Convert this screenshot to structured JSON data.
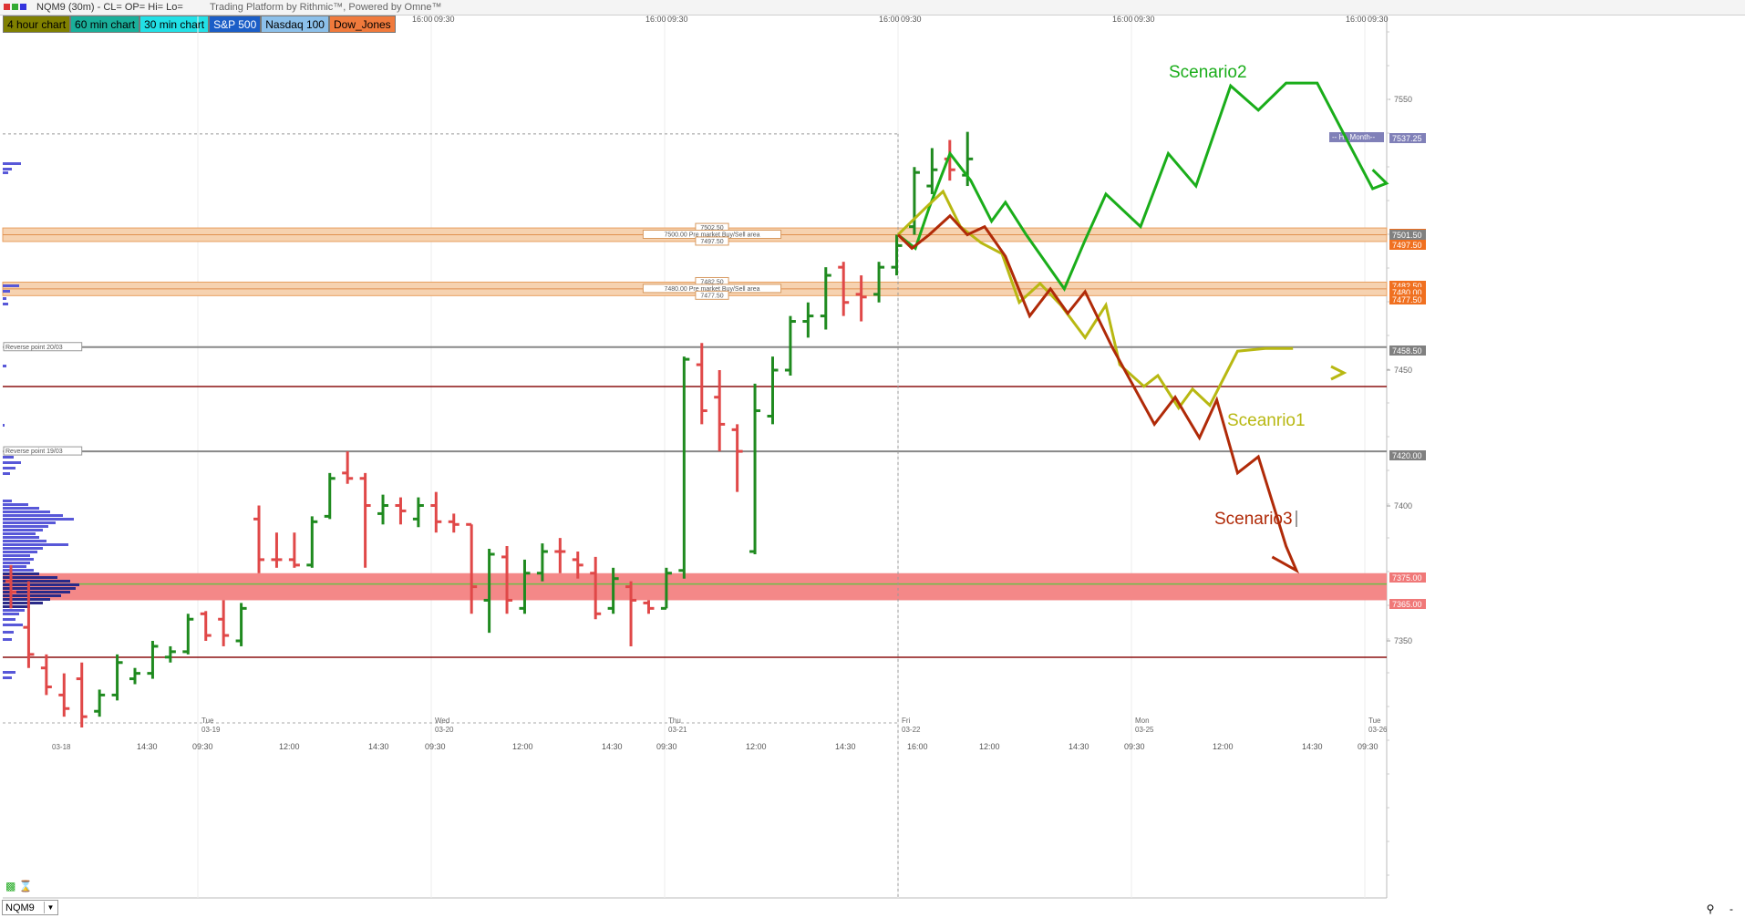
{
  "window": {
    "title": "NQM9 (30m) - CL= OP= Hi= Lo=",
    "subtitle": "Trading Platform by Rithmic™, Powered by Omne™"
  },
  "tabs": [
    {
      "label": "4 hour chart",
      "bg": "#808000",
      "fg": "#000000"
    },
    {
      "label": "60 min chart",
      "bg": "#1aaf9a",
      "fg": "#000000"
    },
    {
      "label": "30 min chart",
      "bg": "#22e0e6",
      "fg": "#000000"
    },
    {
      "label": "S&P 500",
      "bg": "#1b5ec7",
      "fg": "#ffffff"
    },
    {
      "label": "Nasdaq 100",
      "bg": "#8cc0ea",
      "fg": "#000000"
    },
    {
      "label": "Dow_Jones",
      "bg": "#f07a3c",
      "fg": "#000000"
    }
  ],
  "symbol": "NQM9",
  "colors": {
    "up_bar": "#1f8a1f",
    "down_bar": "#e04848",
    "scenario1": "#b8b812",
    "scenario2": "#1aad1a",
    "scenario3": "#b02a08",
    "zone_red": "#f48888",
    "zone_orange": "#f6d2b0",
    "profile_blue": "#5858d8"
  },
  "top_time_labels": [
    "16:00",
    "09:30",
    "16:00",
    "09:30",
    "16:00",
    "09:30",
    "16:00",
    "09:30",
    "16:00",
    "09:30"
  ],
  "bottom_date_labels": [
    "03-18",
    "Tue 03-19",
    "Wed 03-20",
    "Thu 03-21",
    "Fri 03-22",
    "Mon 03-25",
    "Tue 03-26"
  ],
  "bottom_time_labels": [
    "14:30",
    "09:30",
    "12:00",
    "14:30",
    "09:30",
    "12:00",
    "14:30",
    "09:30",
    "12:00",
    "14:30",
    "16:00",
    "12:00",
    "14:30",
    "09:30",
    "12:00",
    "14:30",
    "09:30"
  ],
  "price_axis": {
    "ticks": [
      "7550",
      "7450",
      "7400",
      "7350"
    ],
    "badges": [
      {
        "label": "7537.25",
        "color": "#8080b8"
      },
      {
        "label": "7502.50",
        "color": "#f07020"
      },
      {
        "label": "7501.50",
        "color": "#808080"
      },
      {
        "label": "7497.50",
        "color": "#f07020"
      },
      {
        "label": "7482.50",
        "color": "#f07020"
      },
      {
        "label": "7480.00",
        "color": "#f07020"
      },
      {
        "label": "7477.50",
        "color": "#f07020"
      },
      {
        "label": "7458.50",
        "color": "#808080"
      },
      {
        "label": "7420.00",
        "color": "#808080"
      },
      {
        "label": "7375.00",
        "color": "#f07878"
      },
      {
        "label": "7365.00",
        "color": "#f07878"
      }
    ]
  },
  "annotations": {
    "hi_month": "-- Hi_Month--",
    "zone1_top": "7502.50",
    "zone1_mid": "7500.00 Pre market Buy/Sell area",
    "zone1_bot": "7497.50",
    "zone2_top": "7482.50",
    "zone2_mid": "7480.00 Pre market Buy/Sell area",
    "zone2_bot": "7477.50",
    "reverse1": "Reverse point 20/03",
    "reverse2": "Reverse point 19/03",
    "scenario1": "Sceanrio1",
    "scenario2": "Scenario2",
    "scenario3": "Scenario3"
  },
  "bars": [
    [
      "d",
      7378,
      7362,
      7372,
      7368
    ],
    [
      "d",
      7372,
      7340,
      7355,
      7345
    ],
    [
      "d",
      7345,
      7330,
      7340,
      7333
    ],
    [
      "d",
      7338,
      7322,
      7330,
      7325
    ],
    [
      "d",
      7342,
      7318,
      7336,
      7322
    ],
    [
      "u",
      7332,
      7322,
      7324,
      7330
    ],
    [
      "u",
      7345,
      7328,
      7330,
      7342
    ],
    [
      "u",
      7340,
      7334,
      7336,
      7338
    ],
    [
      "u",
      7350,
      7336,
      7338,
      7348
    ],
    [
      "u",
      7348,
      7342,
      7344,
      7346
    ],
    [
      "u",
      7360,
      7345,
      7346,
      7358
    ],
    [
      "d",
      7361,
      7350,
      7360,
      7352
    ],
    [
      "d",
      7365,
      7348,
      7358,
      7352
    ],
    [
      "u",
      7364,
      7348,
      7350,
      7362
    ],
    [
      "d",
      7400,
      7375,
      7395,
      7380
    ],
    [
      "d",
      7390,
      7377,
      7380,
      7380
    ],
    [
      "d",
      7390,
      7377,
      7380,
      7378
    ],
    [
      "u",
      7396,
      7377,
      7378,
      7394
    ],
    [
      "u",
      7412,
      7395,
      7396,
      7410
    ],
    [
      "d",
      7420,
      7408,
      7412,
      7410
    ],
    [
      "d",
      7412,
      7377,
      7410,
      7400
    ],
    [
      "u",
      7404,
      7393,
      7397,
      7400
    ],
    [
      "d",
      7403,
      7393,
      7400,
      7398
    ],
    [
      "u",
      7403,
      7392,
      7395,
      7400
    ],
    [
      "d",
      7405,
      7390,
      7400,
      7394
    ],
    [
      "d",
      7397,
      7390,
      7394,
      7393
    ],
    [
      "d",
      7393,
      7360,
      7393,
      7370
    ],
    [
      "u",
      7384,
      7353,
      7365,
      7382
    ],
    [
      "d",
      7385,
      7360,
      7381,
      7365
    ],
    [
      "u",
      7380,
      7360,
      7362,
      7375
    ],
    [
      "u",
      7386,
      7372,
      7375,
      7383
    ],
    [
      "d",
      7388,
      7375,
      7383,
      7383
    ],
    [
      "d",
      7383,
      7373,
      7380,
      7378
    ],
    [
      "d",
      7381,
      7358,
      7375,
      7360
    ],
    [
      "u",
      7377,
      7360,
      7362,
      7373
    ],
    [
      "d",
      7372,
      7348,
      7370,
      7365
    ],
    [
      "d",
      7365,
      7360,
      7364,
      7362
    ],
    [
      "u",
      7377,
      7362,
      7362,
      7375
    ],
    [
      "u",
      7455,
      7373,
      7376,
      7454
    ],
    [
      "d",
      7460,
      7430,
      7452,
      7435
    ],
    [
      "d",
      7450,
      7420,
      7440,
      7430
    ],
    [
      "d",
      7430,
      7405,
      7428,
      7420
    ],
    [
      "u",
      7445,
      7382,
      7383,
      7435
    ],
    [
      "u",
      7455,
      7430,
      7433,
      7450
    ],
    [
      "u",
      7470,
      7448,
      7450,
      7468
    ],
    [
      "u",
      7475,
      7462,
      7468,
      7470
    ],
    [
      "u",
      7488,
      7465,
      7470,
      7485
    ],
    [
      "d",
      7490,
      7470,
      7488,
      7475
    ],
    [
      "d",
      7485,
      7468,
      7478,
      7477
    ],
    [
      "u",
      7490,
      7475,
      7478,
      7488
    ],
    [
      "u",
      7500,
      7485,
      7488,
      7496
    ],
    [
      "u",
      7525,
      7500,
      7503,
      7523
    ],
    [
      "u",
      7532,
      7515,
      7518,
      7524
    ],
    [
      "d",
      7535,
      7520,
      7528,
      7524
    ],
    [
      "u",
      7538,
      7518,
      7522,
      7528
    ]
  ],
  "scenarios": {
    "scenario2": [
      [
        0,
        7500
      ],
      [
        5,
        7495
      ],
      [
        9,
        7510
      ],
      [
        15,
        7530
      ],
      [
        21,
        7520
      ],
      [
        27,
        7505
      ],
      [
        31,
        7512
      ],
      [
        37,
        7500
      ],
      [
        48,
        7480
      ],
      [
        54,
        7498
      ],
      [
        60,
        7515
      ],
      [
        70,
        7503
      ],
      [
        78,
        7530
      ],
      [
        86,
        7518
      ],
      [
        96,
        7555
      ],
      [
        104,
        7546
      ],
      [
        112,
        7556
      ],
      [
        121,
        7556
      ],
      [
        130,
        7534
      ],
      [
        137,
        7517
      ],
      [
        141,
        7519
      ],
      [
        137,
        7524
      ]
    ],
    "scenario1": [
      [
        0,
        7500
      ],
      [
        8,
        7510
      ],
      [
        13,
        7516
      ],
      [
        18,
        7503
      ],
      [
        24,
        7497
      ],
      [
        30,
        7493
      ],
      [
        35,
        7475
      ],
      [
        41,
        7482
      ],
      [
        47,
        7474
      ],
      [
        54,
        7462
      ],
      [
        60,
        7474
      ],
      [
        64,
        7452
      ],
      [
        71,
        7444
      ],
      [
        75,
        7448
      ],
      [
        81,
        7436
      ],
      [
        85,
        7443
      ],
      [
        90,
        7437
      ],
      [
        98,
        7457
      ],
      [
        106,
        7458
      ],
      [
        114,
        7458
      ]
    ],
    "scenario3": [
      [
        0,
        7500
      ],
      [
        4,
        7495
      ],
      [
        9,
        7500
      ],
      [
        15,
        7507
      ],
      [
        20,
        7500
      ],
      [
        25,
        7503
      ],
      [
        31,
        7492
      ],
      [
        38,
        7470
      ],
      [
        44,
        7480
      ],
      [
        49,
        7471
      ],
      [
        54,
        7479
      ],
      [
        62,
        7458
      ],
      [
        74,
        7430
      ],
      [
        80,
        7440
      ],
      [
        87,
        7425
      ],
      [
        92,
        7439
      ],
      [
        98,
        7412
      ],
      [
        104,
        7418
      ],
      [
        112,
        7385
      ],
      [
        115,
        7376
      ],
      [
        108,
        7381
      ]
    ]
  }
}
